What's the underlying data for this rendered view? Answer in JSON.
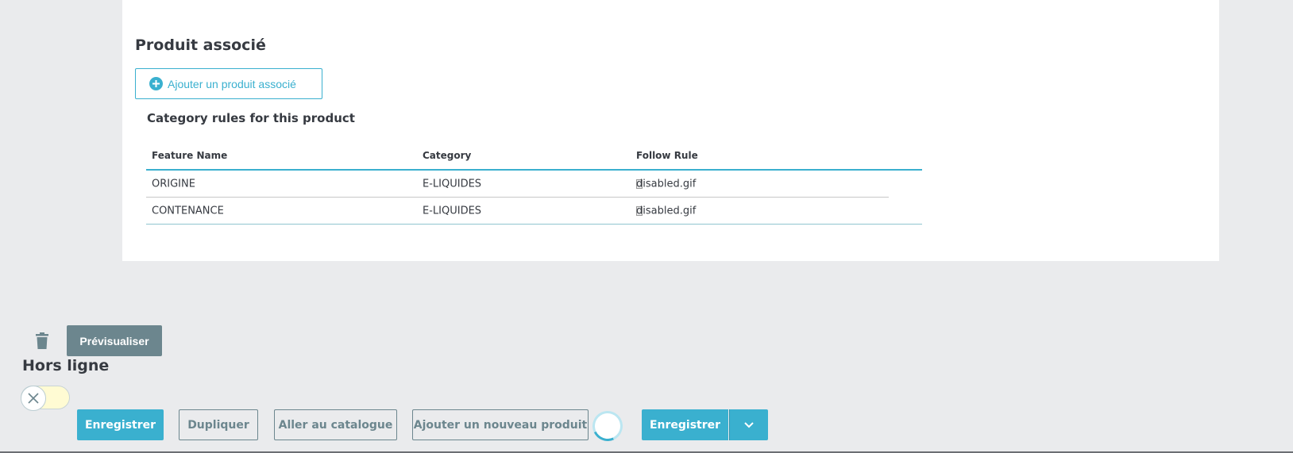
{
  "related": {
    "title": "Produit associé",
    "add_button_label": "Ajouter un produit associé"
  },
  "category_rules": {
    "title": "Category rules for this product",
    "columns": [
      "Feature Name",
      "Category",
      "Follow Rule"
    ],
    "rows": [
      {
        "feature": "ORIGINE",
        "category": "E-LIQUIDES",
        "follow_rule_alt": "disabled.gif"
      },
      {
        "feature": "CONTENANCE",
        "category": "E-LIQUIDES",
        "follow_rule_alt": "disabled.gif"
      }
    ]
  },
  "footer": {
    "preview_label": "Prévisualiser",
    "status_label": "Hors ligne",
    "toggle_state": "off",
    "save_label": "Enregistrer",
    "duplicate_label": "Dupliquer",
    "catalog_label": "Aller au catalogue",
    "new_product_label": "Ajouter un nouveau produit",
    "save_right_label": "Enregistrer"
  },
  "icons": {
    "delete": "trash-icon",
    "add": "plus-circle-icon",
    "toggle_off": "close-icon",
    "dropdown": "chevron-down-icon",
    "loading": "spinner-icon"
  },
  "colors": {
    "accent": "#3ab0cf",
    "secondary": "#6c868e",
    "background": "#eaebed"
  }
}
